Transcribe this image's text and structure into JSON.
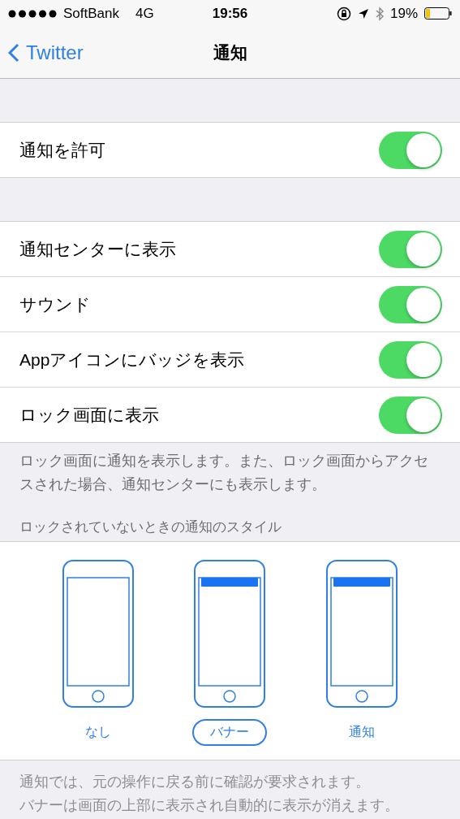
{
  "status_bar": {
    "carrier": "SoftBank",
    "network": "4G",
    "time": "19:56",
    "battery": "19%"
  },
  "nav": {
    "back": "Twitter",
    "title": "通知"
  },
  "sections": [
    {
      "rows": [
        {
          "label": "通知を許可",
          "on": true
        }
      ]
    },
    {
      "rows": [
        {
          "label": "通知センターに表示",
          "on": true
        },
        {
          "label": "サウンド",
          "on": true
        },
        {
          "label": "Appアイコンにバッジを表示",
          "on": true
        },
        {
          "label": "ロック画面に表示",
          "on": true
        }
      ],
      "footer": "ロック画面に通知を表示します。また、ロック画面からアクセスされた場合、通知センターにも表示します。"
    }
  ],
  "style_header": "ロックされていないときの通知のスタイル",
  "styles": [
    {
      "kind": "none",
      "label": "なし",
      "selected": false
    },
    {
      "kind": "banner",
      "label": "バナー",
      "selected": true
    },
    {
      "kind": "alert",
      "label": "通知",
      "selected": false
    }
  ],
  "style_footer": [
    "通知では、元の操作に戻る前に確認が要求されます。",
    "バナーは画面の上部に表示され自動的に表示が消えます。"
  ]
}
